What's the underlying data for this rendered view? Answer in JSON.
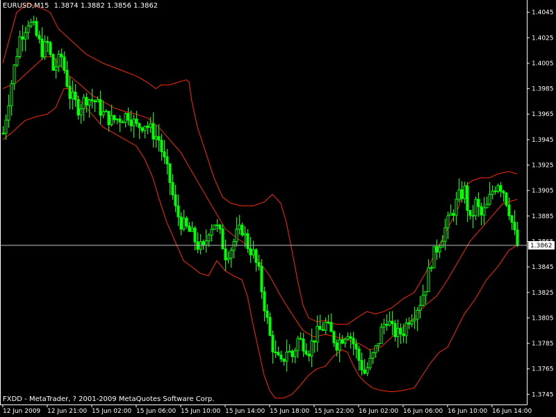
{
  "window": {
    "symbol_timeframe": "EURUSD,M15",
    "ohlc_text": "1.3874 1.3882 1.3856 1.3862",
    "copyright": "FXDD - MetaTrader, ? 2001-2009 MetaQuotes Software Corp."
  },
  "colors": {
    "background": "#000000",
    "candle": "#00ff00",
    "band": "#ff2a00",
    "axis": "#ffffff",
    "bid_line": "#c0c0c0",
    "price_tag_bg": "#ffffff",
    "price_tag_text": "#000000"
  },
  "chart_data": {
    "type": "candlestick",
    "indicator": "Bollinger Bands",
    "current_price": 1.3862,
    "current_price_label": "1.3862",
    "ylim": [
      1.3737,
      1.4053
    ],
    "y_ticks": [
      1.4045,
      1.4025,
      1.4005,
      1.3985,
      1.3965,
      1.3945,
      1.3925,
      1.3905,
      1.3885,
      1.3865,
      1.3845,
      1.3825,
      1.3805,
      1.3785,
      1.3765,
      1.3745
    ],
    "y_tick_labels": [
      "1.4045",
      "1.4025",
      "1.4005",
      "1.3985",
      "1.3965",
      "1.3945",
      "1.3925",
      "1.3905",
      "1.3885",
      "1.3865",
      "1.3845",
      "1.3825",
      "1.3805",
      "1.3785",
      "1.3765",
      "1.3745"
    ],
    "x_ticks": [
      {
        "bar": 0,
        "label": "12 Jun 2009"
      },
      {
        "bar": 16,
        "label": "12 Jun 21:00"
      },
      {
        "bar": 32,
        "label": "15 Jun 02:00"
      },
      {
        "bar": 48,
        "label": "15 Jun 06:00"
      },
      {
        "bar": 64,
        "label": "15 Jun 10:00"
      },
      {
        "bar": 80,
        "label": "15 Jun 14:00"
      },
      {
        "bar": 96,
        "label": "15 Jun 18:00"
      },
      {
        "bar": 112,
        "label": "15 Jun 22:00"
      },
      {
        "bar": 128,
        "label": "16 Jun 02:00"
      },
      {
        "bar": 144,
        "label": "16 Jun 06:00"
      },
      {
        "bar": 160,
        "label": "16 Jun 10:00"
      },
      {
        "bar": 176,
        "label": "16 Jun 14:00"
      }
    ],
    "close_path": [
      [
        0,
        1.395
      ],
      [
        3,
        1.399
      ],
      [
        6,
        1.4025
      ],
      [
        9,
        1.4038
      ],
      [
        11,
        1.4032
      ],
      [
        14,
        1.4015
      ],
      [
        16,
        1.402
      ],
      [
        18,
        1.4
      ],
      [
        21,
        1.401
      ],
      [
        24,
        1.398
      ],
      [
        27,
        1.397
      ],
      [
        30,
        1.3978
      ],
      [
        33,
        1.3975
      ],
      [
        36,
        1.3965
      ],
      [
        39,
        1.396
      ],
      [
        42,
        1.3962
      ],
      [
        45,
        1.3965
      ],
      [
        48,
        1.3955
      ],
      [
        51,
        1.3958
      ],
      [
        54,
        1.395
      ],
      [
        56,
        1.3945
      ],
      [
        58,
        1.3928
      ],
      [
        60,
        1.3912
      ],
      [
        62,
        1.389
      ],
      [
        64,
        1.388
      ],
      [
        66,
        1.3875
      ],
      [
        68,
        1.387
      ],
      [
        70,
        1.3862
      ],
      [
        72,
        1.3858
      ],
      [
        74,
        1.3875
      ],
      [
        76,
        1.388
      ],
      [
        78,
        1.387
      ],
      [
        80,
        1.3855
      ],
      [
        82,
        1.386
      ],
      [
        84,
        1.387
      ],
      [
        86,
        1.3875
      ],
      [
        88,
        1.3862
      ],
      [
        90,
        1.3855
      ],
      [
        92,
        1.384
      ],
      [
        94,
        1.3815
      ],
      [
        96,
        1.379
      ],
      [
        98,
        1.3775
      ],
      [
        100,
        1.3768
      ],
      [
        102,
        1.378
      ],
      [
        104,
        1.3775
      ],
      [
        106,
        1.3788
      ],
      [
        108,
        1.3785
      ],
      [
        110,
        1.378
      ],
      [
        112,
        1.379
      ],
      [
        114,
        1.3795
      ],
      [
        116,
        1.38
      ],
      [
        118,
        1.3792
      ],
      [
        120,
        1.3785
      ],
      [
        122,
        1.379
      ],
      [
        124,
        1.3795
      ],
      [
        126,
        1.3785
      ],
      [
        128,
        1.3772
      ],
      [
        130,
        1.3762
      ],
      [
        132,
        1.377
      ],
      [
        134,
        1.378
      ],
      [
        136,
        1.3795
      ],
      [
        138,
        1.3805
      ],
      [
        140,
        1.3795
      ],
      [
        142,
        1.3792
      ],
      [
        144,
        1.3795
      ],
      [
        146,
        1.3805
      ],
      [
        148,
        1.381
      ],
      [
        150,
        1.3818
      ],
      [
        152,
        1.383
      ],
      [
        154,
        1.385
      ],
      [
        156,
        1.386
      ],
      [
        158,
        1.387
      ],
      [
        160,
        1.388
      ],
      [
        162,
        1.389
      ],
      [
        164,
        1.39
      ],
      [
        166,
        1.3905
      ],
      [
        168,
        1.388
      ],
      [
        170,
        1.3895
      ],
      [
        172,
        1.3885
      ],
      [
        174,
        1.3892
      ],
      [
        176,
        1.3905
      ],
      [
        178,
        1.3912
      ],
      [
        180,
        1.3905
      ],
      [
        182,
        1.389
      ],
      [
        184,
        1.387
      ],
      [
        185,
        1.3862
      ]
    ],
    "upper_band": [
      [
        0,
        1.4005
      ],
      [
        5,
        1.4045
      ],
      [
        9,
        1.4052
      ],
      [
        14,
        1.4048
      ],
      [
        17,
        1.4045
      ],
      [
        20,
        1.4032
      ],
      [
        25,
        1.4022
      ],
      [
        30,
        1.4012
      ],
      [
        36,
        1.4005
      ],
      [
        42,
        1.4
      ],
      [
        48,
        1.3995
      ],
      [
        52,
        1.399
      ],
      [
        55,
        1.3985
      ],
      [
        57,
        1.3988
      ],
      [
        60,
        1.3988
      ],
      [
        63,
        1.399
      ],
      [
        66,
        1.3992
      ],
      [
        67,
        1.399
      ],
      [
        68,
        1.3975
      ],
      [
        70,
        1.3955
      ],
      [
        73,
        1.3935
      ],
      [
        76,
        1.3915
      ],
      [
        79,
        1.39
      ],
      [
        82,
        1.3895
      ],
      [
        86,
        1.3893
      ],
      [
        90,
        1.3893
      ],
      [
        94,
        1.3896
      ],
      [
        97,
        1.3902
      ],
      [
        100,
        1.3895
      ],
      [
        102,
        1.388
      ],
      [
        104,
        1.3858
      ],
      [
        106,
        1.3835
      ],
      [
        108,
        1.3815
      ],
      [
        110,
        1.3805
      ],
      [
        113,
        1.3802
      ],
      [
        116,
        1.3803
      ],
      [
        120,
        1.38
      ],
      [
        124,
        1.38
      ],
      [
        128,
        1.3806
      ],
      [
        131,
        1.381
      ],
      [
        134,
        1.3808
      ],
      [
        137,
        1.381
      ],
      [
        140,
        1.3813
      ],
      [
        144,
        1.382
      ],
      [
        148,
        1.3825
      ],
      [
        152,
        1.384
      ],
      [
        156,
        1.3858
      ],
      [
        160,
        1.3875
      ],
      [
        164,
        1.3892
      ],
      [
        166,
        1.3908
      ],
      [
        169,
        1.3913
      ],
      [
        172,
        1.3915
      ],
      [
        175,
        1.3915
      ],
      [
        178,
        1.3918
      ],
      [
        182,
        1.392
      ],
      [
        185,
        1.3918
      ]
    ],
    "middle_band": [
      [
        0,
        1.3985
      ],
      [
        5,
        1.399
      ],
      [
        10,
        1.4
      ],
      [
        15,
        1.401
      ],
      [
        18,
        1.401
      ],
      [
        20,
        1.4005
      ],
      [
        24,
        1.3995
      ],
      [
        28,
        1.3988
      ],
      [
        32,
        1.398
      ],
      [
        36,
        1.3975
      ],
      [
        40,
        1.397
      ],
      [
        44,
        1.3967
      ],
      [
        48,
        1.3965
      ],
      [
        52,
        1.3962
      ],
      [
        56,
        1.3955
      ],
      [
        60,
        1.3945
      ],
      [
        64,
        1.3935
      ],
      [
        68,
        1.392
      ],
      [
        72,
        1.3905
      ],
      [
        76,
        1.389
      ],
      [
        80,
        1.3875
      ],
      [
        84,
        1.3868
      ],
      [
        88,
        1.3862
      ],
      [
        92,
        1.385
      ],
      [
        96,
        1.3838
      ],
      [
        100,
        1.3822
      ],
      [
        104,
        1.3808
      ],
      [
        108,
        1.3795
      ],
      [
        112,
        1.379
      ],
      [
        116,
        1.3792
      ],
      [
        120,
        1.379
      ],
      [
        124,
        1.3788
      ],
      [
        128,
        1.3785
      ],
      [
        132,
        1.378
      ],
      [
        136,
        1.3782
      ],
      [
        140,
        1.379
      ],
      [
        144,
        1.3798
      ],
      [
        148,
        1.3805
      ],
      [
        152,
        1.3815
      ],
      [
        156,
        1.3822
      ],
      [
        160,
        1.3835
      ],
      [
        164,
        1.385
      ],
      [
        168,
        1.3865
      ],
      [
        172,
        1.3875
      ],
      [
        176,
        1.3885
      ],
      [
        180,
        1.3895
      ],
      [
        185,
        1.3898
      ]
    ],
    "lower_band": [
      [
        0,
        1.3945
      ],
      [
        3,
        1.395
      ],
      [
        8,
        1.396
      ],
      [
        12,
        1.3963
      ],
      [
        16,
        1.3965
      ],
      [
        19,
        1.397
      ],
      [
        22,
        1.3985
      ],
      [
        25,
        1.3985
      ],
      [
        28,
        1.3975
      ],
      [
        32,
        1.3965
      ],
      [
        36,
        1.3955
      ],
      [
        40,
        1.395
      ],
      [
        44,
        1.3945
      ],
      [
        48,
        1.394
      ],
      [
        51,
        1.393
      ],
      [
        54,
        1.3915
      ],
      [
        56,
        1.39
      ],
      [
        59,
        1.388
      ],
      [
        62,
        1.3865
      ],
      [
        65,
        1.385
      ],
      [
        68,
        1.3845
      ],
      [
        71,
        1.384
      ],
      [
        74,
        1.3838
      ],
      [
        77,
        1.385
      ],
      [
        80,
        1.3842
      ],
      [
        83,
        1.3838
      ],
      [
        86,
        1.3835
      ],
      [
        88,
        1.3822
      ],
      [
        90,
        1.38
      ],
      [
        92,
        1.378
      ],
      [
        94,
        1.376
      ],
      [
        96,
        1.3748
      ],
      [
        98,
        1.3742
      ],
      [
        101,
        1.3742
      ],
      [
        104,
        1.3745
      ],
      [
        107,
        1.3752
      ],
      [
        110,
        1.376
      ],
      [
        113,
        1.3765
      ],
      [
        116,
        1.3767
      ],
      [
        119,
        1.3775
      ],
      [
        122,
        1.378
      ],
      [
        124,
        1.3778
      ],
      [
        126,
        1.3768
      ],
      [
        128,
        1.376
      ],
      [
        130,
        1.3755
      ],
      [
        133,
        1.375
      ],
      [
        136,
        1.3748
      ],
      [
        140,
        1.3747
      ],
      [
        144,
        1.3748
      ],
      [
        148,
        1.375
      ],
      [
        151,
        1.376
      ],
      [
        154,
        1.377
      ],
      [
        157,
        1.3778
      ],
      [
        160,
        1.3782
      ],
      [
        163,
        1.3795
      ],
      [
        166,
        1.3808
      ],
      [
        170,
        1.382
      ],
      [
        174,
        1.3835
      ],
      [
        178,
        1.3845
      ],
      [
        182,
        1.3858
      ],
      [
        185,
        1.3862
      ]
    ]
  }
}
